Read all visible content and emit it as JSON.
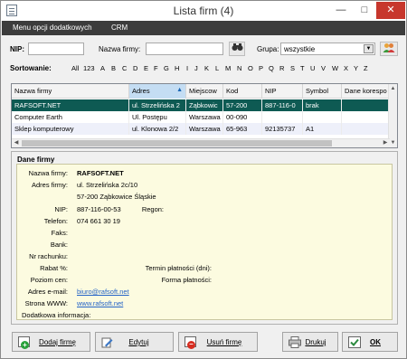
{
  "window": {
    "title": "Lista firm (4)",
    "minimize_glyph": "—",
    "maximize_glyph": "□",
    "close_glyph": "✕"
  },
  "menu": {
    "items": [
      "Menu opcji dodatkowych",
      "CRM"
    ]
  },
  "filters": {
    "nip_label": "NIP:",
    "nip_value": "",
    "name_label": "Nazwa firmy:",
    "name_value": "",
    "search_icon": "binoculars-icon",
    "group_label": "Grupa:",
    "group_value": "wszystkie",
    "groups_icon": "people-icon"
  },
  "sorting": {
    "label": "Sortowanie:",
    "letters": [
      "All",
      "123",
      "A",
      "B",
      "C",
      "D",
      "E",
      "F",
      "G",
      "H",
      "I",
      "J",
      "K",
      "L",
      "M",
      "N",
      "O",
      "P",
      "Q",
      "R",
      "S",
      "T",
      "U",
      "V",
      "W",
      "X",
      "Y",
      "Z"
    ]
  },
  "table": {
    "columns": [
      "Nazwa firmy",
      "Adres",
      "Miejscow",
      "Kod",
      "NIP",
      "Symbol",
      "Dane korespo"
    ],
    "sorted_column": "Adres",
    "rows": [
      [
        "RAFSOFT.NET",
        "ul. Strzelińska 2",
        "Ząbkowic",
        "57-200",
        "887-116-0",
        "brak",
        ""
      ],
      [
        "Computer Earth",
        "Ul. Postępu",
        "Warszawa",
        "00-090",
        "",
        "",
        ""
      ],
      [
        "Sklep komputerowy",
        "ul. Klonowa 2/2",
        "Warszawa",
        "65-963",
        "92135737",
        "A1",
        ""
      ]
    ],
    "selected_row": 0
  },
  "details": {
    "group_title": "Dane firmy",
    "labels": {
      "name": "Nazwa firmy:",
      "address": "Adres firmy:",
      "nip": "NIP:",
      "regon": "Regon:",
      "phone": "Telefon:",
      "fax": "Faks:",
      "bank": "Bank:",
      "account": "Nr rachunku:",
      "discount": "Rabat %:",
      "payment_term": "Termin płatności (dni):",
      "price_level": "Poziom cen:",
      "payment_form": "Forma płatności:",
      "email": "Adres e-mail:",
      "www": "Strona WWW:",
      "extra": "Dodatkowa informacja:"
    },
    "values": {
      "name": "RAFSOFT.NET",
      "address_line1": "ul. Strzelińska 2c/10",
      "address_line2": "57-200 Ząbkowice Śląskie",
      "nip": "887-116-00-53",
      "phone": "074 661 30 19",
      "email": "biuro@rafsoft.net",
      "www": "www.rafsoft.net"
    }
  },
  "buttons": {
    "add": "Dodaj firmę",
    "edit": "Edytuj",
    "delete": "Usuń firmę",
    "print": "Drukuj",
    "ok": "OK"
  }
}
